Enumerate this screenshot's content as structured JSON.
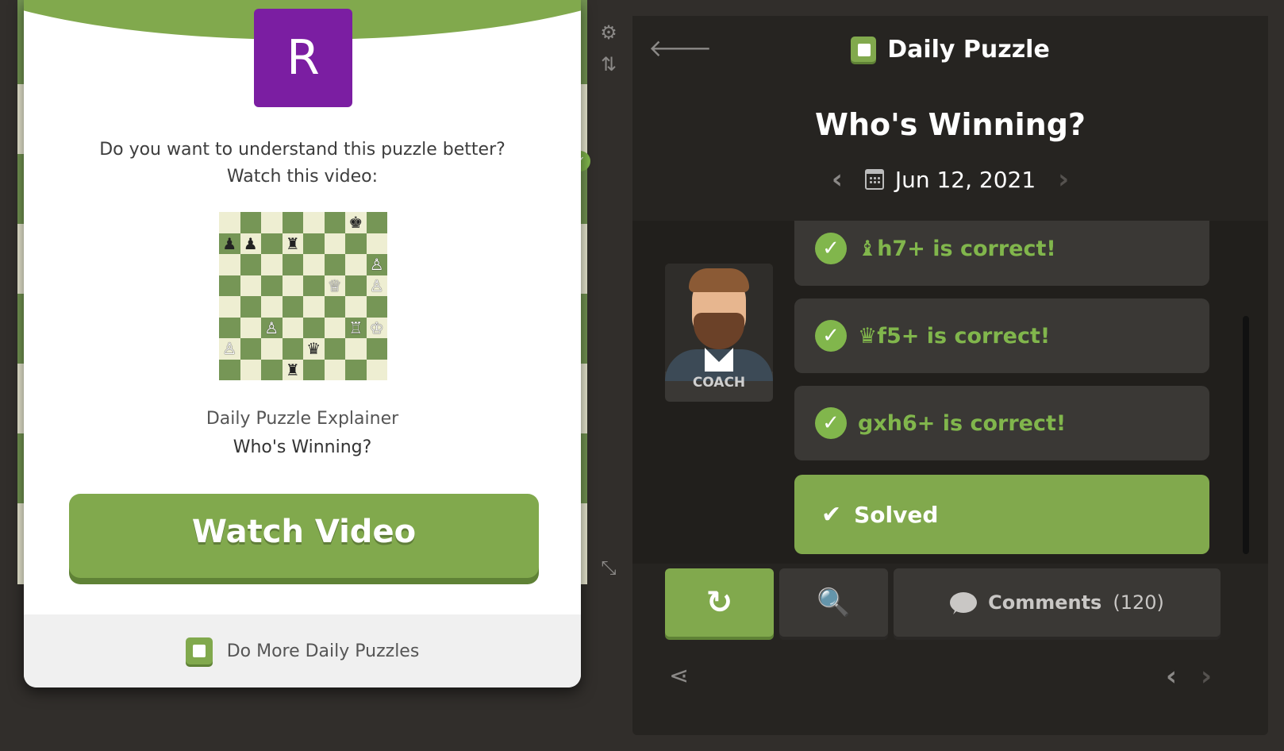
{
  "modal": {
    "avatar_letter": "R",
    "question_line1": "Do you want to understand this puzzle better?",
    "question_line2": "Watch this video:",
    "caption_line1": "Daily Puzzle Explainer",
    "caption_line2": "Who's Winning?",
    "watch_button": "Watch Video",
    "footer_link": "Do More Daily Puzzles",
    "colors": {
      "brand_green": "#81a94d",
      "avatar_purple": "#7b1ea2"
    },
    "mini_board": [
      [
        "",
        "",
        "",
        "",
        "",
        "",
        "♚",
        ""
      ],
      [
        "♟",
        "♟",
        "",
        "♜",
        "",
        "",
        "",
        ""
      ],
      [
        "",
        "",
        "",
        "",
        "",
        "",
        "",
        "♙"
      ],
      [
        "",
        "",
        "",
        "",
        "",
        "♕",
        "",
        "♙"
      ],
      [
        "",
        "",
        "",
        "",
        "",
        "",
        "",
        ""
      ],
      [
        "",
        "",
        "♙",
        "",
        "",
        "",
        "♖",
        "♔"
      ],
      [
        "♙",
        "",
        "",
        "",
        "♛",
        "",
        "",
        ""
      ],
      [
        "",
        "",
        "",
        "♜",
        "",
        "",
        "",
        ""
      ]
    ]
  },
  "panel": {
    "title": "Daily Puzzle",
    "puzzle_name": "Who's Winning?",
    "date": "Jun 12, 2021",
    "coach_label": "COACH",
    "moves": [
      {
        "text": "♝h7+ is correct!"
      },
      {
        "text": "♛f5+ is correct!"
      },
      {
        "text": "gxh6+ is correct!"
      }
    ],
    "solved_label": "Solved",
    "comments_label": "Comments",
    "comments_count": "(120)",
    "icons": {
      "back": "back-arrow-icon",
      "settings": "gear-icon",
      "flip": "flip-board-icon",
      "expand": "expand-icon",
      "calendar": "calendar-icon",
      "retry": "retry-icon",
      "zoom": "analysis-zoom-icon",
      "share": "share-icon"
    },
    "colors": {
      "correct_green": "#81b64c",
      "panel_bg": "#262421"
    }
  }
}
